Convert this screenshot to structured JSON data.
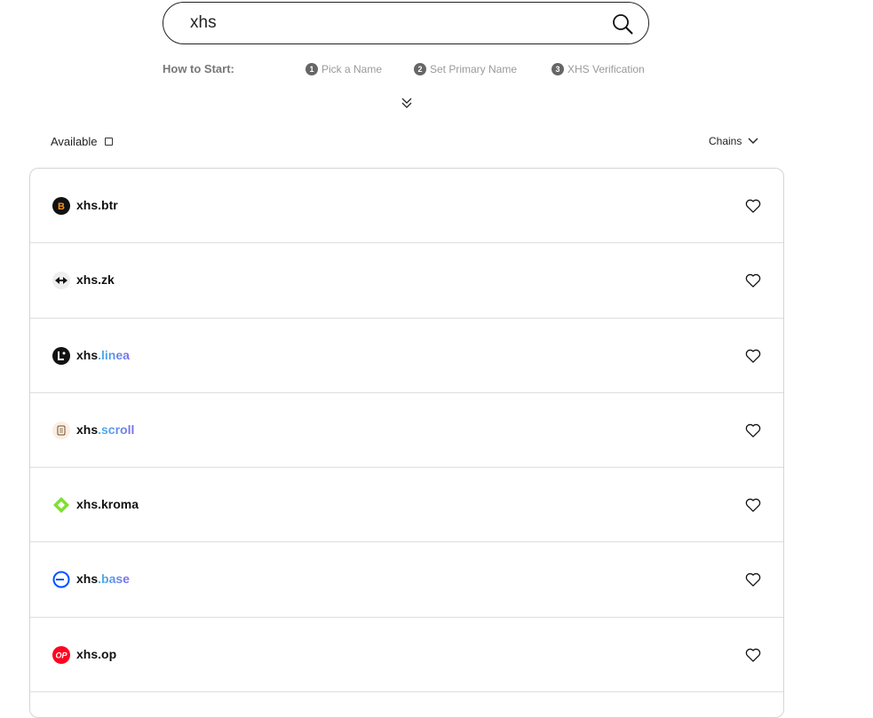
{
  "search": {
    "value": "xhs",
    "placeholder": ""
  },
  "how_to_start": {
    "label": "How to Start:",
    "steps": [
      {
        "num": "1",
        "label": "Pick a Name"
      },
      {
        "num": "2",
        "label": "Set Primary Name"
      },
      {
        "num": "3",
        "label": "XHS Verification"
      }
    ]
  },
  "filters": {
    "available_label": "Available",
    "chains_label": "Chains"
  },
  "results": [
    {
      "base": "xhs",
      "tld": ".btr",
      "tld_style": "plain",
      "icon": "bitlayer-icon"
    },
    {
      "base": "xhs",
      "tld": ".zk",
      "tld_style": "plain",
      "icon": "zksync-icon"
    },
    {
      "base": "xhs",
      "tld": ".linea",
      "tld_style": "gradient",
      "icon": "linea-icon"
    },
    {
      "base": "xhs",
      "tld": ".scroll",
      "tld_style": "gradient",
      "icon": "scroll-icon"
    },
    {
      "base": "xhs",
      "tld": ".kroma",
      "tld_style": "plain",
      "icon": "kroma-icon"
    },
    {
      "base": "xhs",
      "tld": ".base",
      "tld_style": "gradient",
      "icon": "base-icon"
    },
    {
      "base": "xhs",
      "tld": ".op",
      "tld_style": "plain",
      "icon": "optimism-icon"
    }
  ],
  "colors": {
    "accent_gradient_start": "#3fb6e8",
    "accent_gradient_end": "#7d6cf0",
    "border": "#d4d4d4",
    "optimism_red": "#ff0420",
    "base_blue": "#0052ff",
    "kroma_green": "#7fe030"
  }
}
